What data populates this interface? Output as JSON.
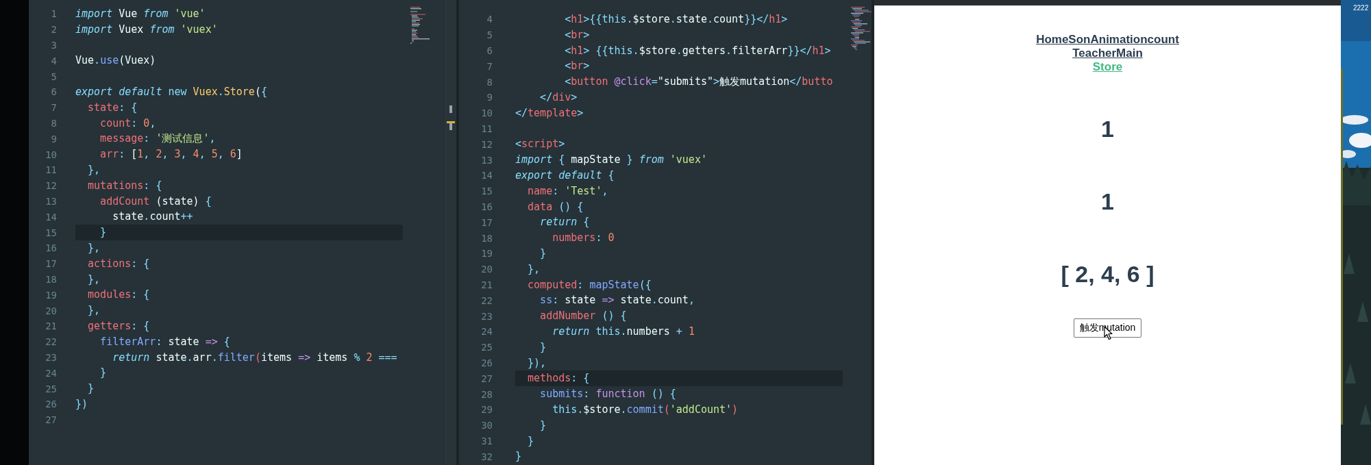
{
  "left_editor": {
    "lines": [
      {
        "number": "1",
        "current": false,
        "tokens": [
          {
            "text": "import",
            "kind": "keyword"
          },
          {
            "text": " Vue ",
            "kind": "plain"
          },
          {
            "text": "from",
            "kind": "keyword"
          },
          {
            "text": " 'vue'",
            "kind": "string"
          }
        ]
      },
      {
        "number": "2",
        "current": false,
        "tokens": [
          {
            "text": "import",
            "kind": "keyword"
          },
          {
            "text": " Vuex ",
            "kind": "plain"
          },
          {
            "text": "from",
            "kind": "keyword"
          },
          {
            "text": " 'vuex'",
            "kind": "string"
          }
        ]
      },
      {
        "number": "3",
        "current": false
      },
      {
        "number": "4",
        "current": false,
        "tokens": [
          {
            "text": "Vue",
            "kind": "plain"
          },
          {
            "text": ".",
            "kind": "punct"
          },
          {
            "text": "use",
            "kind": "function"
          },
          {
            "text": "(Vuex)",
            "kind": "plain"
          }
        ]
      },
      {
        "number": "5",
        "current": false
      },
      {
        "number": "6",
        "current": false,
        "tokens": [
          {
            "text": "export default",
            "kind": "keyword"
          },
          {
            "text": " new",
            "kind": "punct"
          },
          {
            "text": " Vuex",
            "kind": "class"
          },
          {
            "text": ".",
            "kind": "punct"
          },
          {
            "text": "Store",
            "kind": "class"
          },
          {
            "text": "(",
            "kind": "plain"
          },
          {
            "text": "{",
            "kind": "punct"
          }
        ]
      },
      {
        "number": "7",
        "current": false,
        "tokens": [
          {
            "text": "  state",
            "kind": "property"
          },
          {
            "text": ": {",
            "kind": "punct"
          }
        ]
      },
      {
        "number": "8",
        "current": false,
        "tokens": [
          {
            "text": "    count",
            "kind": "property"
          },
          {
            "text": ": ",
            "kind": "punct"
          },
          {
            "text": "0",
            "kind": "number"
          },
          {
            "text": ",",
            "kind": "punct"
          }
        ]
      },
      {
        "number": "9",
        "current": false,
        "tokens": [
          {
            "text": "    message",
            "kind": "property"
          },
          {
            "text": ": ",
            "kind": "punct"
          },
          {
            "text": "'测试信息'",
            "kind": "string"
          },
          {
            "text": ",",
            "kind": "punct"
          }
        ]
      },
      {
        "number": "10",
        "current": false,
        "tokens": [
          {
            "text": "    arr",
            "kind": "property"
          },
          {
            "text": ": ",
            "kind": "punct"
          },
          {
            "text": "[",
            "kind": "plain"
          },
          {
            "text": "1",
            "kind": "number"
          },
          {
            "text": ", ",
            "kind": "punct"
          },
          {
            "text": "2",
            "kind": "number"
          },
          {
            "text": ", ",
            "kind": "punct"
          },
          {
            "text": "3",
            "kind": "number"
          },
          {
            "text": ", ",
            "kind": "punct"
          },
          {
            "text": "4",
            "kind": "number"
          },
          {
            "text": ", ",
            "kind": "punct"
          },
          {
            "text": "5",
            "kind": "number"
          },
          {
            "text": ", ",
            "kind": "punct"
          },
          {
            "text": "6",
            "kind": "number"
          },
          {
            "text": "]",
            "kind": "plain"
          }
        ]
      },
      {
        "number": "11",
        "current": false,
        "tokens": [
          {
            "text": "  },",
            "kind": "punct"
          }
        ]
      },
      {
        "number": "12",
        "current": false,
        "tokens": [
          {
            "text": "  mutations",
            "kind": "property"
          },
          {
            "text": ": {",
            "kind": "punct"
          }
        ]
      },
      {
        "number": "13",
        "current": false,
        "tokens": [
          {
            "text": "    addCount",
            "kind": "property"
          },
          {
            "text": " (state) ",
            "kind": "plain"
          },
          {
            "text": "{",
            "kind": "punct"
          }
        ]
      },
      {
        "number": "14",
        "current": false,
        "tokens": [
          {
            "text": "      state",
            "kind": "plain"
          },
          {
            "text": ".",
            "kind": "punct"
          },
          {
            "text": "count",
            "kind": "plain"
          },
          {
            "text": "++",
            "kind": "punct"
          }
        ]
      },
      {
        "number": "15",
        "current": true,
        "tokens": [
          {
            "text": "    }",
            "kind": "punct"
          }
        ]
      },
      {
        "number": "16",
        "current": false,
        "tokens": [
          {
            "text": "  },",
            "kind": "punct"
          }
        ]
      },
      {
        "number": "17",
        "current": false,
        "tokens": [
          {
            "text": "  actions",
            "kind": "property"
          },
          {
            "text": ": {",
            "kind": "punct"
          }
        ]
      },
      {
        "number": "18",
        "current": false,
        "tokens": [
          {
            "text": "  },",
            "kind": "punct"
          }
        ]
      },
      {
        "number": "19",
        "current": false,
        "tokens": [
          {
            "text": "  modules",
            "kind": "property"
          },
          {
            "text": ": {",
            "kind": "punct"
          }
        ]
      },
      {
        "number": "20",
        "current": false,
        "tokens": [
          {
            "text": "  },",
            "kind": "punct"
          }
        ]
      },
      {
        "number": "21",
        "current": false,
        "tokens": [
          {
            "text": "  getters",
            "kind": "property"
          },
          {
            "text": ": {",
            "kind": "punct"
          }
        ]
      },
      {
        "number": "22",
        "current": false,
        "tokens": [
          {
            "text": "    filterArr",
            "kind": "function"
          },
          {
            "text": ": ",
            "kind": "punct"
          },
          {
            "text": "state ",
            "kind": "plain"
          },
          {
            "text": "=>",
            "kind": "storage"
          },
          {
            "text": " {",
            "kind": "punct"
          }
        ]
      },
      {
        "number": "23",
        "current": false,
        "tokens": [
          {
            "text": "      return",
            "kind": "keyword"
          },
          {
            "text": " state",
            "kind": "plain"
          },
          {
            "text": ".",
            "kind": "punct"
          },
          {
            "text": "arr",
            "kind": "plain"
          },
          {
            "text": ".",
            "kind": "punct"
          },
          {
            "text": "filter",
            "kind": "function"
          },
          {
            "text": "(",
            "kind": "property"
          },
          {
            "text": "items ",
            "kind": "plain"
          },
          {
            "text": "=>",
            "kind": "storage"
          },
          {
            "text": " items ",
            "kind": "plain"
          },
          {
            "text": "%",
            "kind": "punct"
          },
          {
            "text": " 2",
            "kind": "number"
          },
          {
            "text": " ===",
            "kind": "punct"
          }
        ]
      },
      {
        "number": "24",
        "current": false,
        "tokens": [
          {
            "text": "    }",
            "kind": "punct"
          }
        ]
      },
      {
        "number": "25",
        "current": false,
        "tokens": [
          {
            "text": "  }",
            "kind": "punct"
          }
        ]
      },
      {
        "number": "26",
        "current": false,
        "tokens": [
          {
            "text": "})",
            "kind": "punct"
          }
        ]
      },
      {
        "number": "27",
        "current": false
      }
    ]
  },
  "right_editor": {
    "lines": [
      {
        "number": "4",
        "current": false,
        "tokens": [
          {
            "text": "        <",
            "kind": "punct"
          },
          {
            "text": "h1",
            "kind": "tag"
          },
          {
            "text": ">{{",
            "kind": "punct"
          },
          {
            "text": "this",
            "kind": "punct"
          },
          {
            "text": ".",
            "kind": "punct"
          },
          {
            "text": "$store",
            "kind": "plain"
          },
          {
            "text": ".",
            "kind": "punct"
          },
          {
            "text": "state",
            "kind": "plain"
          },
          {
            "text": ".",
            "kind": "punct"
          },
          {
            "text": "count",
            "kind": "plain"
          },
          {
            "text": "}}</",
            "kind": "punct"
          },
          {
            "text": "h1",
            "kind": "tag"
          },
          {
            "text": ">",
            "kind": "punct"
          }
        ]
      },
      {
        "number": "5",
        "current": false,
        "tokens": [
          {
            "text": "        <",
            "kind": "punct"
          },
          {
            "text": "br",
            "kind": "tag"
          },
          {
            "text": ">",
            "kind": "punct"
          }
        ]
      },
      {
        "number": "6",
        "current": false,
        "tokens": [
          {
            "text": "        <",
            "kind": "punct"
          },
          {
            "text": "h1",
            "kind": "tag"
          },
          {
            "text": "> {{",
            "kind": "punct"
          },
          {
            "text": "this",
            "kind": "punct"
          },
          {
            "text": ".",
            "kind": "punct"
          },
          {
            "text": "$store",
            "kind": "plain"
          },
          {
            "text": ".",
            "kind": "punct"
          },
          {
            "text": "getters",
            "kind": "plain"
          },
          {
            "text": ".",
            "kind": "punct"
          },
          {
            "text": "filterArr",
            "kind": "plain"
          },
          {
            "text": "}}</",
            "kind": "punct"
          },
          {
            "text": "h1",
            "kind": "tag"
          },
          {
            "text": ">",
            "kind": "punct"
          }
        ]
      },
      {
        "number": "7",
        "current": false,
        "tokens": [
          {
            "text": "        <",
            "kind": "punct"
          },
          {
            "text": "br",
            "kind": "tag"
          },
          {
            "text": ">",
            "kind": "punct"
          }
        ]
      },
      {
        "number": "8",
        "current": false,
        "tokens": [
          {
            "text": "        <",
            "kind": "punct"
          },
          {
            "text": "button",
            "kind": "tag"
          },
          {
            "text": " @click",
            "kind": "storage"
          },
          {
            "text": "=",
            "kind": "punct"
          },
          {
            "text": "\"submits\"",
            "kind": "plain"
          },
          {
            "text": ">",
            "kind": "punct"
          },
          {
            "text": "触发mutation",
            "kind": "plain"
          },
          {
            "text": "</",
            "kind": "punct"
          },
          {
            "text": "butto",
            "kind": "tag"
          }
        ]
      },
      {
        "number": "9",
        "current": false,
        "tokens": [
          {
            "text": "    </",
            "kind": "punct"
          },
          {
            "text": "div",
            "kind": "tag"
          },
          {
            "text": ">",
            "kind": "punct"
          }
        ]
      },
      {
        "number": "10",
        "current": false,
        "tokens": [
          {
            "text": "</",
            "kind": "punct"
          },
          {
            "text": "template",
            "kind": "tag"
          },
          {
            "text": ">",
            "kind": "punct"
          }
        ]
      },
      {
        "number": "11",
        "current": false
      },
      {
        "number": "12",
        "current": false,
        "tokens": [
          {
            "text": "<",
            "kind": "punct"
          },
          {
            "text": "script",
            "kind": "tag"
          },
          {
            "text": ">",
            "kind": "punct"
          }
        ]
      },
      {
        "number": "13",
        "current": false,
        "tokens": [
          {
            "text": "import",
            "kind": "keyword"
          },
          {
            "text": " { ",
            "kind": "punct"
          },
          {
            "text": "mapState",
            "kind": "plain"
          },
          {
            "text": " } ",
            "kind": "punct"
          },
          {
            "text": "from",
            "kind": "keyword"
          },
          {
            "text": " 'vuex'",
            "kind": "string"
          }
        ]
      },
      {
        "number": "14",
        "current": false,
        "tokens": [
          {
            "text": "export default",
            "kind": "keyword"
          },
          {
            "text": " {",
            "kind": "punct"
          }
        ]
      },
      {
        "number": "15",
        "current": false,
        "tokens": [
          {
            "text": "  name",
            "kind": "property"
          },
          {
            "text": ": ",
            "kind": "punct"
          },
          {
            "text": "'Test'",
            "kind": "string"
          },
          {
            "text": ",",
            "kind": "punct"
          }
        ]
      },
      {
        "number": "16",
        "current": false,
        "tokens": [
          {
            "text": "  data",
            "kind": "property"
          },
          {
            "text": " () {",
            "kind": "punct"
          }
        ]
      },
      {
        "number": "17",
        "current": false,
        "tokens": [
          {
            "text": "    return",
            "kind": "keyword"
          },
          {
            "text": " {",
            "kind": "punct"
          }
        ]
      },
      {
        "number": "18",
        "current": false,
        "tokens": [
          {
            "text": "      numbers",
            "kind": "property"
          },
          {
            "text": ": ",
            "kind": "punct"
          },
          {
            "text": "0",
            "kind": "number"
          }
        ]
      },
      {
        "number": "19",
        "current": false,
        "tokens": [
          {
            "text": "    }",
            "kind": "punct"
          }
        ]
      },
      {
        "number": "20",
        "current": false,
        "tokens": [
          {
            "text": "  },",
            "kind": "punct"
          }
        ]
      },
      {
        "number": "21",
        "current": false,
        "tokens": [
          {
            "text": "  computed",
            "kind": "property"
          },
          {
            "text": ": ",
            "kind": "punct"
          },
          {
            "text": "mapState",
            "kind": "function"
          },
          {
            "text": "({",
            "kind": "punct"
          }
        ]
      },
      {
        "number": "22",
        "current": false,
        "tokens": [
          {
            "text": "    ss",
            "kind": "function"
          },
          {
            "text": ": ",
            "kind": "punct"
          },
          {
            "text": "state ",
            "kind": "plain"
          },
          {
            "text": "=>",
            "kind": "storage"
          },
          {
            "text": " state",
            "kind": "plain"
          },
          {
            "text": ".",
            "kind": "punct"
          },
          {
            "text": "count",
            "kind": "plain"
          },
          {
            "text": ",",
            "kind": "punct"
          }
        ]
      },
      {
        "number": "23",
        "current": false,
        "tokens": [
          {
            "text": "    addNumber",
            "kind": "property"
          },
          {
            "text": " () {",
            "kind": "punct"
          }
        ]
      },
      {
        "number": "24",
        "current": false,
        "tokens": [
          {
            "text": "      return",
            "kind": "keyword"
          },
          {
            "text": " this.",
            "kind": "punct"
          },
          {
            "text": "numbers",
            "kind": "plain"
          },
          {
            "text": " + ",
            "kind": "punct"
          },
          {
            "text": "1",
            "kind": "number"
          }
        ]
      },
      {
        "number": "25",
        "current": false,
        "tokens": [
          {
            "text": "    }",
            "kind": "punct"
          }
        ]
      },
      {
        "number": "26",
        "current": false,
        "tokens": [
          {
            "text": "  }),",
            "kind": "punct"
          }
        ]
      },
      {
        "number": "27",
        "current": true,
        "tokens": [
          {
            "text": "  methods",
            "kind": "property"
          },
          {
            "text": ": {",
            "kind": "punct"
          }
        ]
      },
      {
        "number": "28",
        "current": false,
        "tokens": [
          {
            "text": "    submits",
            "kind": "function"
          },
          {
            "text": ": ",
            "kind": "punct"
          },
          {
            "text": "function",
            "kind": "storage"
          },
          {
            "text": " () {",
            "kind": "punct"
          }
        ]
      },
      {
        "number": "29",
        "current": false,
        "tokens": [
          {
            "text": "      this.",
            "kind": "punct"
          },
          {
            "text": "$store",
            "kind": "plain"
          },
          {
            "text": ".",
            "kind": "punct"
          },
          {
            "text": "commit",
            "kind": "function"
          },
          {
            "text": "(",
            "kind": "property"
          },
          {
            "text": "'addCount'",
            "kind": "string"
          },
          {
            "text": ")",
            "kind": "property"
          }
        ]
      },
      {
        "number": "30",
        "current": false,
        "tokens": [
          {
            "text": "    }",
            "kind": "punct"
          }
        ]
      },
      {
        "number": "31",
        "current": false,
        "tokens": [
          {
            "text": "  }",
            "kind": "punct"
          }
        ]
      },
      {
        "number": "32",
        "current": false,
        "tokens": [
          {
            "text": "}",
            "kind": "punct"
          }
        ]
      }
    ]
  },
  "browser": {
    "nav_rows": [
      {
        "links": [
          {
            "label": "Home",
            "selected": false
          },
          {
            "label": "Son",
            "selected": false
          },
          {
            "label": "Animation",
            "selected": false
          },
          {
            "label": "count",
            "selected": false
          }
        ]
      },
      {
        "links": [
          {
            "label": "Teacher",
            "selected": false
          },
          {
            "label": "Main",
            "selected": false
          }
        ]
      },
      {
        "links": [
          {
            "label": "Store",
            "selected": true
          }
        ]
      }
    ],
    "headings": [
      "1",
      "1",
      "[ 2, 4, 6 ]"
    ],
    "button": "触发mutation"
  },
  "desktop": {
    "label": "2222"
  }
}
